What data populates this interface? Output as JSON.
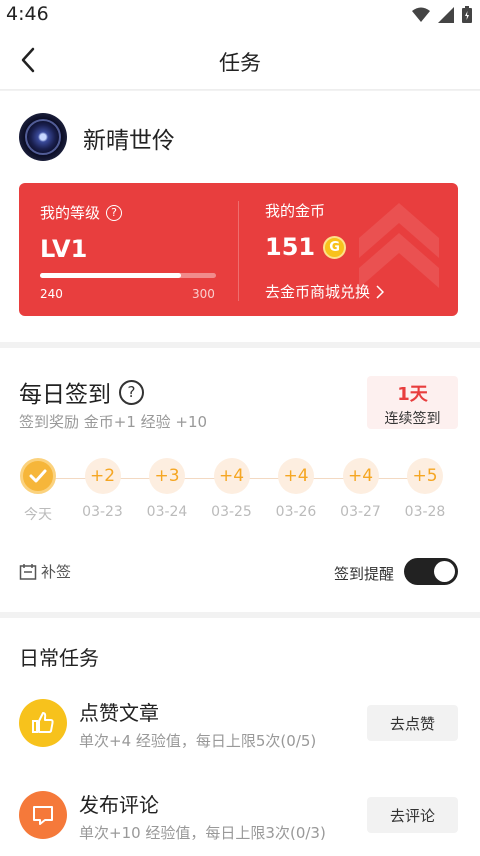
{
  "status_bar": {
    "time": "4:46",
    "icons": [
      "wifi-icon",
      "signal-icon",
      "battery-icon"
    ]
  },
  "nav": {
    "title": "任务"
  },
  "profile": {
    "username": "新晴世伶"
  },
  "level_card": {
    "level_label": "我的等级",
    "level": "LV1",
    "exp_min": "240",
    "exp_max": "300",
    "exp_progress": 0.8,
    "coins_label": "我的金币",
    "coins": "151",
    "coin_symbol": "G",
    "exchange_link": "去金币商城兑换",
    "accent_color": "#e83e3e"
  },
  "signin": {
    "title": "每日签到",
    "reward": "签到奖励 金币+1 经验 +10",
    "streak_days": "1天",
    "streak_label": "连续签到",
    "days": [
      {
        "value": "",
        "date": "今天",
        "done": true
      },
      {
        "value": "+2",
        "date": "03-23",
        "done": false
      },
      {
        "value": "+3",
        "date": "03-24",
        "done": false
      },
      {
        "value": "+4",
        "date": "03-25",
        "done": false
      },
      {
        "value": "+4",
        "date": "03-26",
        "done": false
      },
      {
        "value": "+4",
        "date": "03-27",
        "done": false
      },
      {
        "value": "+5",
        "date": "03-28",
        "done": false
      }
    ],
    "makeup_label": "补签",
    "remind_label": "签到提醒",
    "remind_on": true
  },
  "tasks": {
    "title": "日常任务",
    "items": [
      {
        "name": "点赞文章",
        "desc": "单次+4 经验值，每日上限5次(0/5)",
        "button": "去点赞",
        "icon": "thumbs-up-icon",
        "color": "#f7c21c"
      },
      {
        "name": "发布评论",
        "desc": "单次+10 经验值，每日上限3次(0/3)",
        "button": "去评论",
        "icon": "comment-icon",
        "color": "#f5793a"
      }
    ]
  }
}
